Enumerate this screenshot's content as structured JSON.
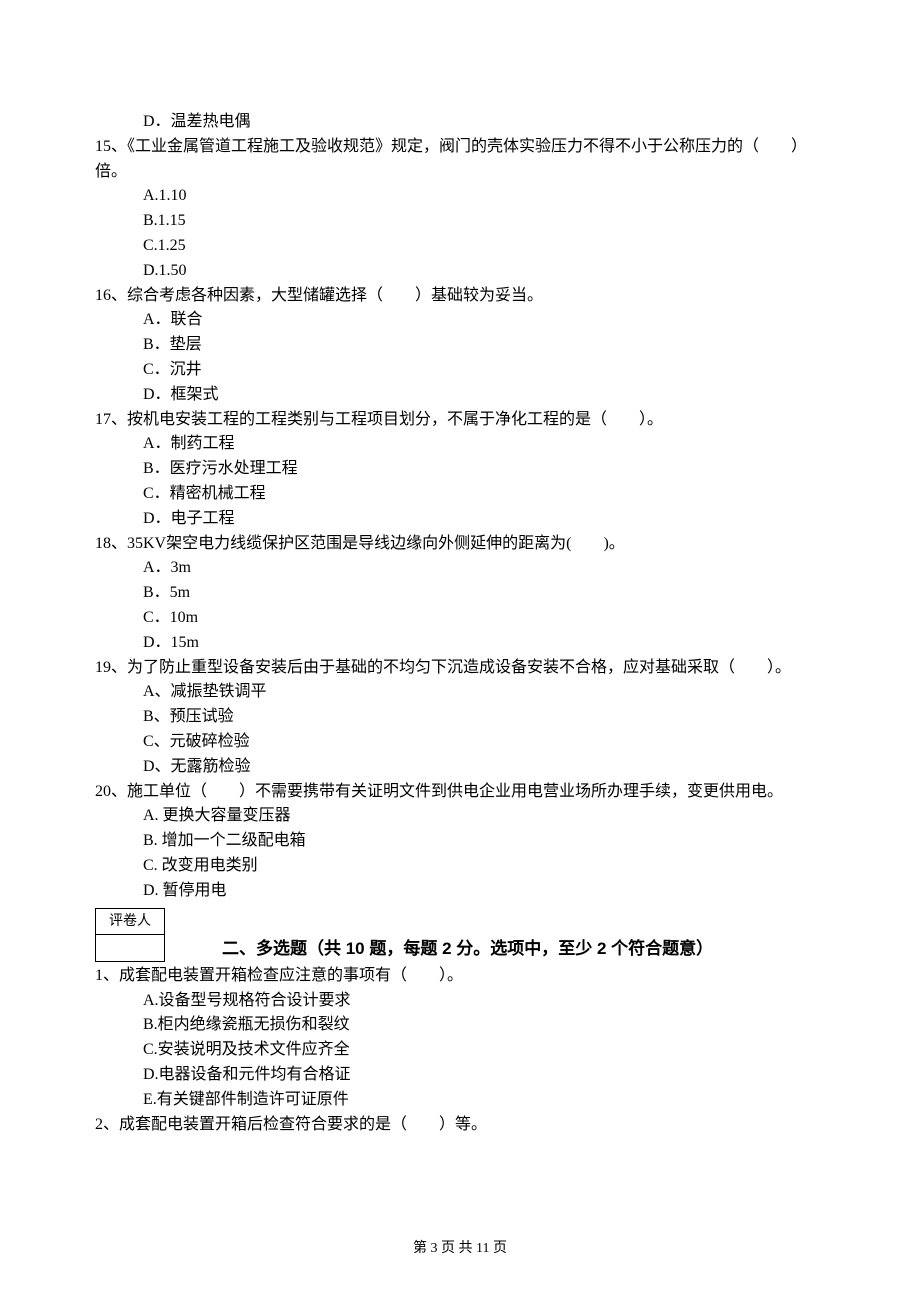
{
  "q14": {
    "d": "D．温差热电偶"
  },
  "q15": {
    "stem": "15、《工业金属管道工程施工及验收规范》规定，阀门的壳体实验压力不得不小于公称压力的（　　）倍。",
    "a": "A.1.10",
    "b": "B.1.15",
    "c": "C.1.25",
    "d": "D.1.50"
  },
  "q16": {
    "stem": "16、综合考虑各种因素，大型储罐选择（　　）基础较为妥当。",
    "a": "A．联合",
    "b": "B．垫层",
    "c": "C．沉井",
    "d": "D．框架式"
  },
  "q17": {
    "stem": "17、按机电安装工程的工程类别与工程项目划分，不属于净化工程的是（　　）。",
    "a": "A．制药工程",
    "b": "B．医疗污水处理工程",
    "c": "C．精密机械工程",
    "d": "D．电子工程"
  },
  "q18": {
    "stem": "18、35KV架空电力线缆保护区范围是导线边缘向外侧延伸的距离为(　　)。",
    "a": "A．3m",
    "b": "B．5m",
    "c": "C．10m",
    "d": "D．15m"
  },
  "q19": {
    "stem": "19、为了防止重型设备安装后由于基础的不均匀下沉造成设备安装不合格，应对基础采取（　　）。",
    "a": "A、减振垫铁调平",
    "b": "B、预压试验",
    "c": "C、元破碎检验",
    "d": "D、无露筋检验"
  },
  "q20": {
    "stem": "20、施工单位（　　）不需要携带有关证明文件到供电企业用电营业场所办理手续，变更供用电。",
    "a": "A. 更换大容量变压器",
    "b": "B. 增加一个二级配电箱",
    "c": "C. 改变用电类别",
    "d": "D. 暂停用电"
  },
  "scorer_label": "评卷人",
  "section2_title": "二、多选题（共 10 题，每题 2 分。选项中，至少 2 个符合题意）",
  "mq1": {
    "stem": "1、成套配电装置开箱检查应注意的事项有（　　）。",
    "a": "A.设备型号规格符合设计要求",
    "b": "B.柜内绝缘瓷瓶无损伤和裂纹",
    "c": "C.安装说明及技术文件应齐全",
    "d": "D.电器设备和元件均有合格证",
    "e": "E.有关键部件制造许可证原件"
  },
  "mq2": {
    "stem": "2、成套配电装置开箱后检查符合要求的是（　　）等。"
  },
  "footer": "第 3 页 共 11 页"
}
